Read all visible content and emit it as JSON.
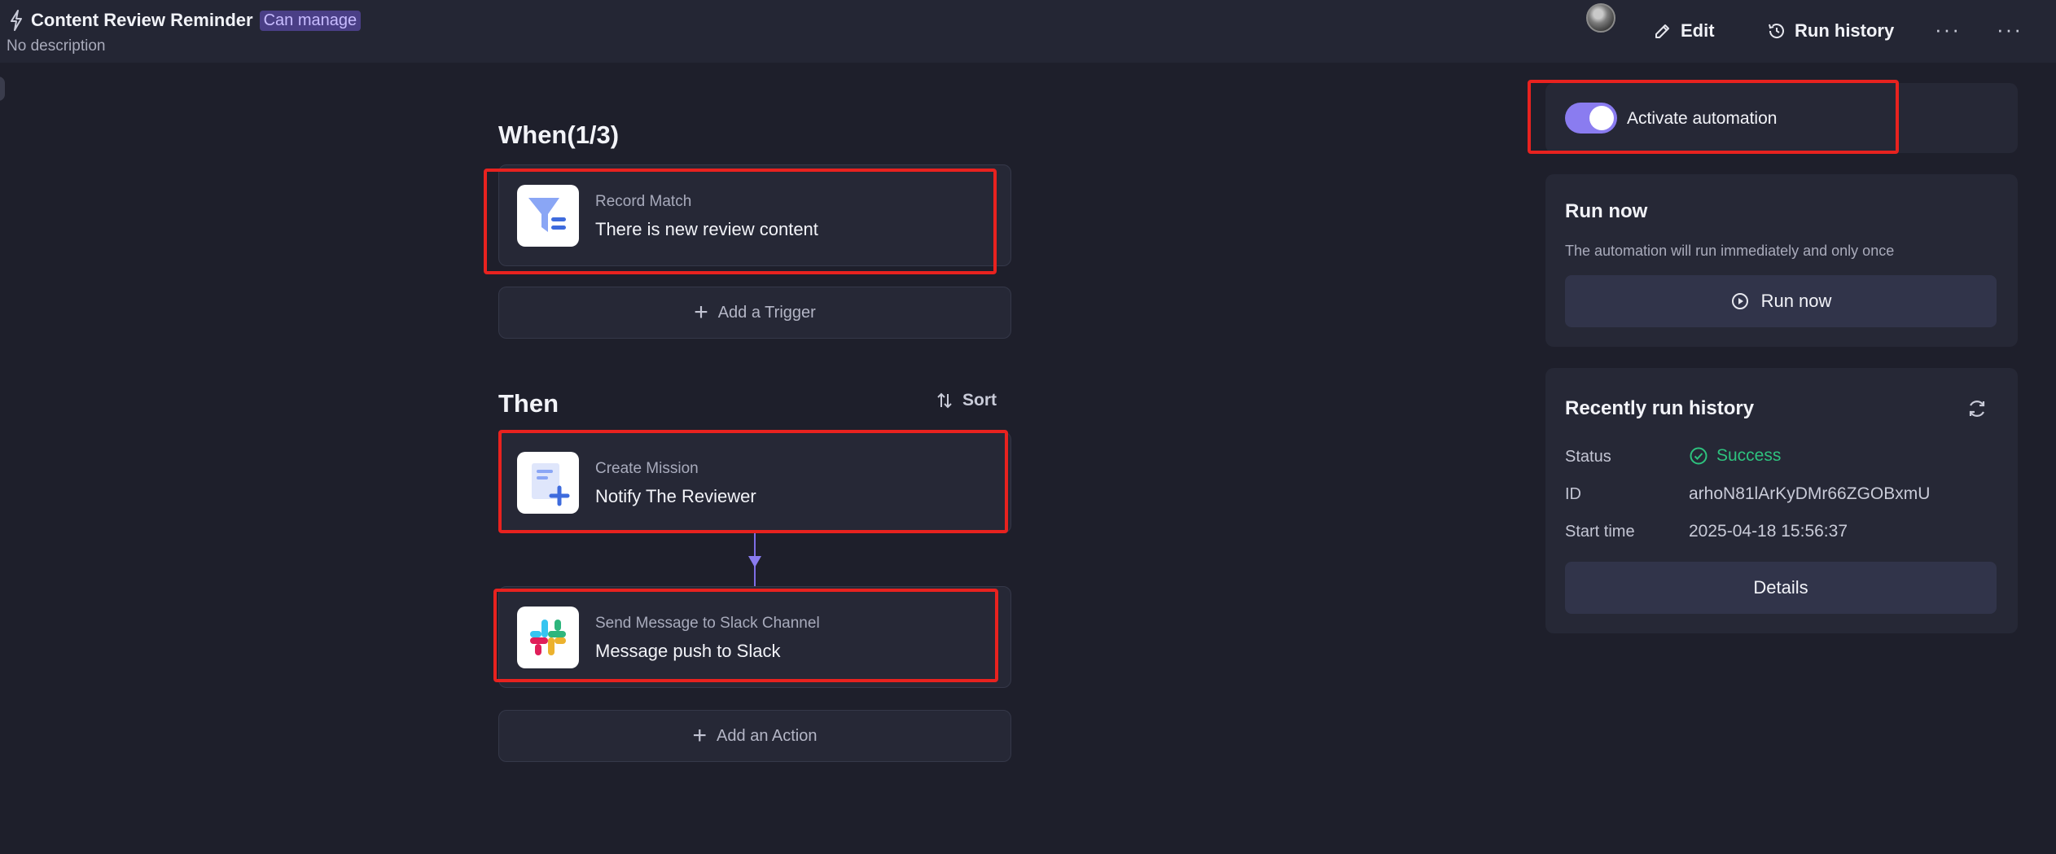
{
  "header": {
    "title": "Content Review Reminder",
    "badge": "Can manage",
    "description": "No description",
    "edit_label": "Edit",
    "run_history_label": "Run history",
    "more_1": "···",
    "more_2": "···"
  },
  "flow": {
    "when_title": "When(1/3)",
    "then_title": "Then",
    "sort_label": "Sort",
    "trigger": {
      "kind": "Record Match",
      "name": "There is new review content",
      "icon": "filter-icon"
    },
    "add_trigger_label": "Add a Trigger",
    "actions": [
      {
        "kind": "Create Mission",
        "name": "Notify The Reviewer",
        "icon": "document-add-icon"
      },
      {
        "kind": "Send Message to Slack Channel",
        "name": "Message push to Slack",
        "icon": "slack-icon"
      }
    ],
    "add_action_label": "Add an Action"
  },
  "panel": {
    "activate_label": "Activate automation",
    "activate_on": true,
    "run_now_title": "Run now",
    "run_now_sub": "The automation will run immediately and only once",
    "run_now_button": "Run now",
    "history_title": "Recently run history",
    "status_label": "Status",
    "status_value": "Success",
    "id_label": "ID",
    "id_value": "arhoN81lArKyDMr66ZGOBxmU",
    "start_label": "Start time",
    "start_value": "2025-04-18 15:56:37",
    "details_button": "Details"
  },
  "colors": {
    "background": "#1e1f2b",
    "card": "#262836",
    "accent": "#8a7cf0",
    "highlight": "#e8221f",
    "success": "#2ec27e"
  }
}
